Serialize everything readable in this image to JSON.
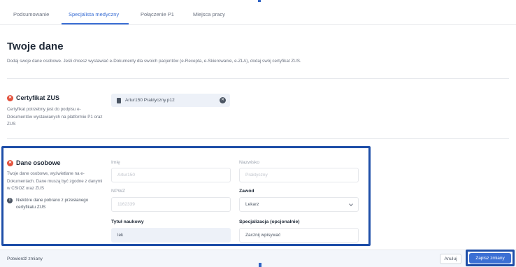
{
  "tabs": [
    {
      "label": "Podsumowanie",
      "active": false
    },
    {
      "label": "Specjalista medyczny",
      "active": true
    },
    {
      "label": "Połączenie P1",
      "active": false
    },
    {
      "label": "Miejsca pracy",
      "active": false
    }
  ],
  "page": {
    "title": "Twoje dane",
    "description": "Dodaj swoje dane osobowe. Jeśli chcesz wystawiać e-Dokumenty dla swoich pacjentów (e-Recepta, e-Skierowanie, e-ZLA), dodaj swój certyfikat ZUS."
  },
  "certificate": {
    "title": "Certyfikat ZUS",
    "description": "Certyfikat potrzebny jest do podpisu e-Dokumentów wystawianych na platformie P1 oraz ZUS",
    "file_name": "Artur150 Praktyczny.p12"
  },
  "personal": {
    "title": "Dane osobowe",
    "description": "Twoje dane osobowe, wyświetlane na e-Dokumentach. Dane muszą być zgodne z danymi w CSIOZ oraz ZUS",
    "note": "Niektóre dane pobrano z przesłanego certyfikatu ZUS",
    "fields": {
      "first_name": {
        "label": "Imię",
        "value": "Artur150"
      },
      "last_name": {
        "label": "Nazwisko",
        "value": "Praktyczny"
      },
      "npwz": {
        "label": "NPWZ",
        "value": "1162339"
      },
      "profession": {
        "label": "Zawód",
        "value": "Lekarz"
      },
      "degree": {
        "label": "Tytuł naukowy",
        "value": "lek"
      },
      "specialization": {
        "label": "Specjalizacja (opcjonalnie)",
        "placeholder": "Zacznij wpisywać"
      }
    }
  },
  "footer": {
    "text": "Potwierdź zmiany",
    "cancel_label": "Anuluj",
    "save_label": "Zapisz zmiany"
  },
  "colors": {
    "accent": "#3b6fd4",
    "error": "#e3503b",
    "highlight": "#1e4ea8"
  },
  "icons": [
    "error-icon",
    "file-icon",
    "remove-icon",
    "info-icon",
    "chevron-down-icon"
  ]
}
